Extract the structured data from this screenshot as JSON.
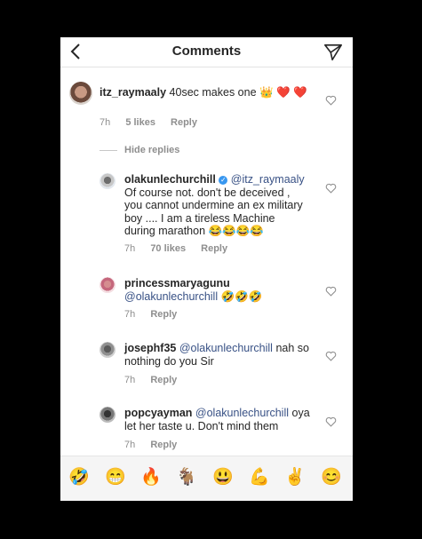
{
  "header": {
    "title": "Comments"
  },
  "comments": [
    {
      "username": "itz_raymaaly",
      "text": "40sec makes one 👑 ❤️ ❤️",
      "time": "7h",
      "likes": "5 likes",
      "reply": "Reply"
    }
  ],
  "hide_replies": "Hide replies",
  "replies": [
    {
      "username": "olakunlechurchill",
      "verified": "✓",
      "mention": "@itz_raymaaly",
      "text": "Of course not.  don't be deceived , you cannot undermine an ex military boy .... I am a tireless Machine during marathon 😂😂😂😂",
      "time": "7h",
      "likes": "70 likes",
      "reply": "Reply"
    },
    {
      "username": "princessmaryagunu",
      "mention": "@olakunlechurchill",
      "text": "🤣🤣🤣",
      "time": "7h",
      "reply": "Reply"
    },
    {
      "username": "josephf35",
      "mention": "@olakunlechurchill",
      "text": "nah so nothing do you Sir",
      "time": "7h",
      "reply": "Reply"
    },
    {
      "username": "popcyayman",
      "mention": "@olakunlechurchill",
      "text": "oya let her taste u. Don't mind them",
      "time": "7h",
      "reply": "Reply"
    }
  ],
  "emoji_bar": [
    "🤣",
    "😁",
    "🔥",
    "🐐",
    "😃",
    "💪",
    "✌️",
    "😊"
  ],
  "colors": {
    "mention": "#385185",
    "meta": "#8e8e8e",
    "background": "#000000"
  }
}
